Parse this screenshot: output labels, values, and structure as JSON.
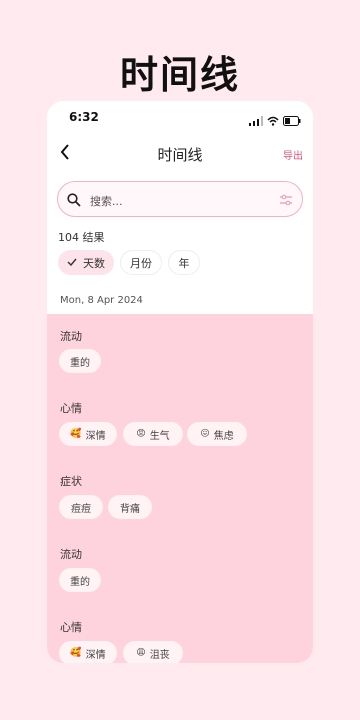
{
  "headline": "时间线",
  "status_bar": {
    "time": "6:32"
  },
  "nav": {
    "title": "时间线",
    "export_label": "导出"
  },
  "search": {
    "placeholder": "搜索..."
  },
  "results_count": "104 结果",
  "segments": [
    "天数",
    "月份",
    "年"
  ],
  "date": "Mon, 8 Apr 2024",
  "sections": [
    {
      "title": "流动",
      "chips": [
        "重的"
      ]
    },
    {
      "title": "心情",
      "chips": [
        "深情",
        "生气",
        "焦虑"
      ]
    },
    {
      "title": "症状",
      "chips": [
        "痘痘",
        "背痛"
      ]
    },
    {
      "title": "流动",
      "chips": [
        "重的"
      ]
    },
    {
      "title": "心情",
      "chips": [
        "深情",
        "沮丧"
      ]
    }
  ],
  "colors": {
    "accent": "#e0527a",
    "panel": "#ffd3dd",
    "background": "#ffeaf0"
  },
  "icons": [
    "back-chevron-icon",
    "search-icon",
    "filter-icon",
    "check-icon",
    "signal-icon",
    "wifi-icon",
    "battery-icon",
    "emoji-icons"
  ]
}
